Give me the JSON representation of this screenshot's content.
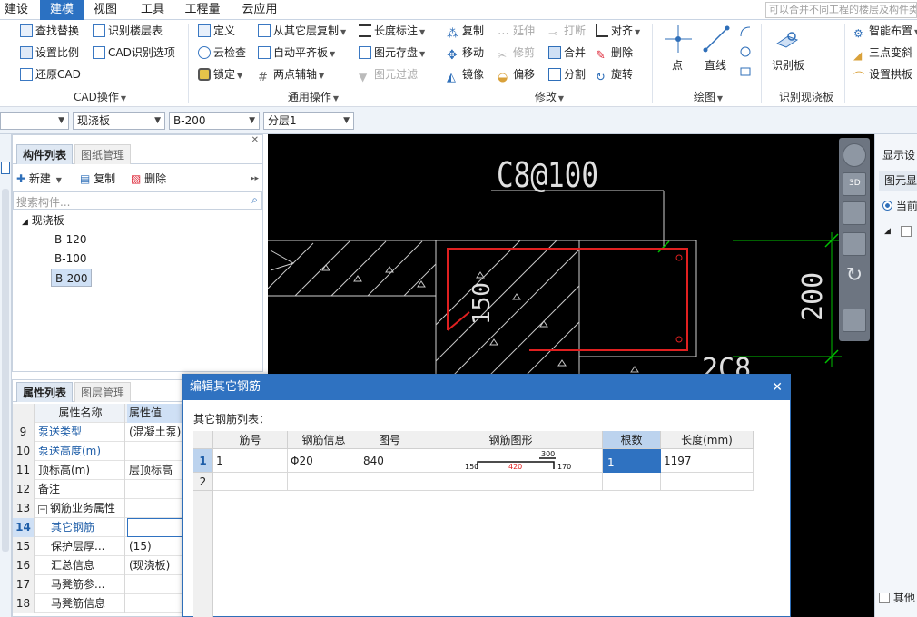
{
  "menubar": {
    "tabs": [
      "建设置",
      "建模",
      "视图",
      "工具",
      "工程量",
      "云应用"
    ],
    "active": "建模",
    "search_placeholder": "可以合并不同工程的楼层及构件类"
  },
  "ribbon": {
    "cad_group": {
      "label": "CAD操作",
      "items": [
        "查找替换",
        "识别楼层表",
        "设置比例",
        "CAD识别选项",
        "还原CAD"
      ]
    },
    "common_group": {
      "label": "通用操作",
      "items": [
        "定义",
        "从其它层复制",
        "长度标注",
        "云检查",
        "自动平齐板",
        "图元存盘",
        "锁定",
        "两点辅轴",
        "图元过滤"
      ]
    },
    "modify_group": {
      "label": "修改",
      "items": [
        "复制",
        "延伸",
        "打断",
        "对齐",
        "移动",
        "修剪",
        "合并",
        "删除",
        "镜像",
        "偏移",
        "分割",
        "旋转"
      ]
    },
    "draw_group": {
      "label": "绘图",
      "items": [
        "点",
        "直线"
      ]
    },
    "identify_group": {
      "label": "识别现浇板",
      "items": [
        "识别板"
      ]
    },
    "smart_group": {
      "items": [
        "智能布置",
        "三点变斜",
        "设置拱板"
      ]
    }
  },
  "selectors": {
    "s1": "",
    "s2": "现浇板",
    "s3": "B-200",
    "s4": "分层1"
  },
  "comp_panel": {
    "tab_active": "构件列表",
    "tab_inactive": "图纸管理",
    "new_label": "新建",
    "copy_label": "复制",
    "delete_label": "删除",
    "search_placeholder": "搜索构件...",
    "tree_root": "现浇板",
    "tree_items": [
      "B-120",
      "B-100",
      "B-200"
    ],
    "selected": "B-200"
  },
  "prop_panel": {
    "tab_active": "属性列表",
    "tab_inactive": "图层管理",
    "col_name": "属性名称",
    "col_value": "属性值",
    "rows": [
      {
        "num": "9",
        "name": "泵送类型",
        "value": "(混凝土泵)"
      },
      {
        "num": "10",
        "name": "泵送高度(m)",
        "value": ""
      },
      {
        "num": "11",
        "name": "顶标高(m)",
        "value": "层顶标高"
      },
      {
        "num": "12",
        "name": "备注",
        "value": ""
      },
      {
        "num": "13",
        "name": "钢筋业务属性",
        "value": ""
      },
      {
        "num": "14",
        "name": "其它钢筋",
        "value": ""
      },
      {
        "num": "15",
        "name": "保护层厚...",
        "value": "(15)"
      },
      {
        "num": "16",
        "name": "汇总信息",
        "value": "(现浇板)"
      },
      {
        "num": "17",
        "name": "马凳筋参...",
        "value": ""
      },
      {
        "num": "18",
        "name": "马凳筋信息",
        "value": ""
      }
    ]
  },
  "canvas": {
    "label_top": "C8@100",
    "label_150": "150",
    "label_200": "200",
    "label_bottom": "2C8"
  },
  "right_panel": {
    "title": "显示设",
    "sub": "图元显",
    "radio_label": "当前",
    "footer": "其他"
  },
  "dialog": {
    "title": "编辑其它钢筋",
    "list_label": "其它钢筋列表：",
    "headers": [
      "筋号",
      "钢筋信息",
      "图号",
      "钢筋图形",
      "根数",
      "长度(mm)"
    ],
    "rows": [
      {
        "num": "1",
        "bar_no": "1",
        "info": "Φ20",
        "fig_no": "840",
        "count": "1",
        "length": "1197"
      },
      {
        "num": "2",
        "bar_no": "",
        "info": "",
        "fig_no": "",
        "count": "",
        "length": ""
      }
    ],
    "shape": {
      "d1": "150",
      "d2": "420",
      "d3": "300",
      "d4": "170"
    }
  },
  "colors": {
    "accent": "#2b71c2",
    "rebar_red": "#e02020",
    "dim_green": "#00c000"
  }
}
